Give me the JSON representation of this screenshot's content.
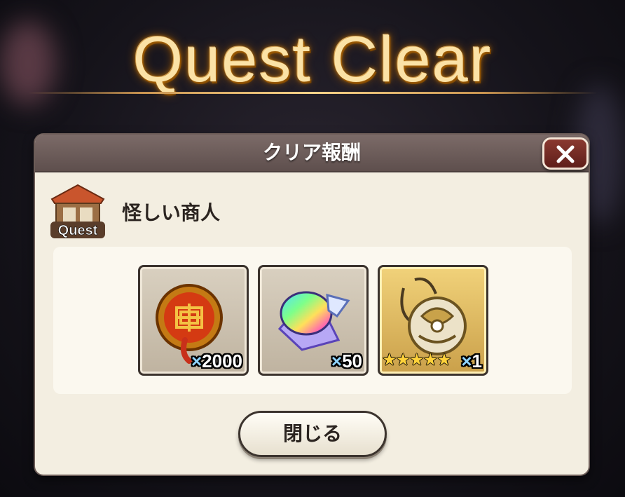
{
  "screen": {
    "title": "Quest Clear"
  },
  "dialog": {
    "title": "クリア報酬",
    "quest_badge": "Quest",
    "quest_name": "怪しい商人",
    "close_button_label": "閉じる"
  },
  "rewards": [
    {
      "icon": "coin-medallion-icon",
      "quantity_prefix": "×",
      "quantity": "2000"
    },
    {
      "icon": "rainbow-crystal-icon",
      "quantity_prefix": "×",
      "quantity": "50"
    },
    {
      "icon": "ornate-orb-pendant-icon",
      "stars": "★★★★★",
      "quantity_prefix": "×",
      "quantity": "1"
    }
  ],
  "colors": {
    "title_gold": "#fbe2a6",
    "header_bg": "#6d5d58",
    "dialog_bg": "#f3eee1",
    "close_red": "#7a2c25",
    "gold_tile": "#e2bd5f"
  }
}
